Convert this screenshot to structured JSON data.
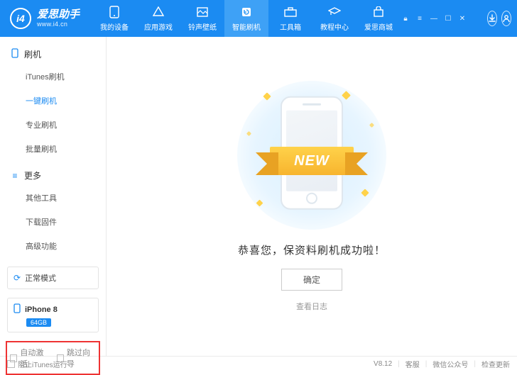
{
  "brand": {
    "name": "爱思助手",
    "url": "www.i4.cn",
    "logo": "i4"
  },
  "nav": {
    "items": [
      {
        "id": "device",
        "label": "我的设备"
      },
      {
        "id": "games",
        "label": "应用游戏"
      },
      {
        "id": "ringwall",
        "label": "铃声壁纸"
      },
      {
        "id": "flash",
        "label": "智能刷机"
      },
      {
        "id": "toolbox",
        "label": "工具箱"
      },
      {
        "id": "tutorial",
        "label": "教程中心"
      },
      {
        "id": "mall",
        "label": "爱思商城"
      }
    ],
    "activeIndex": 3
  },
  "sidebar": {
    "groups": [
      {
        "title": "刷机",
        "icon": "phone",
        "items": [
          "iTunes刷机",
          "一键刷机",
          "专业刷机",
          "批量刷机"
        ],
        "activeIndex": 1
      },
      {
        "title": "更多",
        "icon": "menu",
        "items": [
          "其他工具",
          "下载固件",
          "高级功能"
        ],
        "activeIndex": -1
      }
    ],
    "mode": "正常模式",
    "device": {
      "name": "iPhone 8",
      "storage": "64GB"
    },
    "checks": {
      "autoActivate": "自动激活",
      "skipWizard": "跳过向导"
    }
  },
  "main": {
    "ribbon": "NEW",
    "message": "恭喜您，保资料刷机成功啦！",
    "ok": "确定",
    "viewLog": "查看日志"
  },
  "footer": {
    "blockItunes": "阻止iTunes运行",
    "version": "V8.12",
    "links": [
      "客服",
      "微信公众号",
      "检查更新"
    ]
  }
}
